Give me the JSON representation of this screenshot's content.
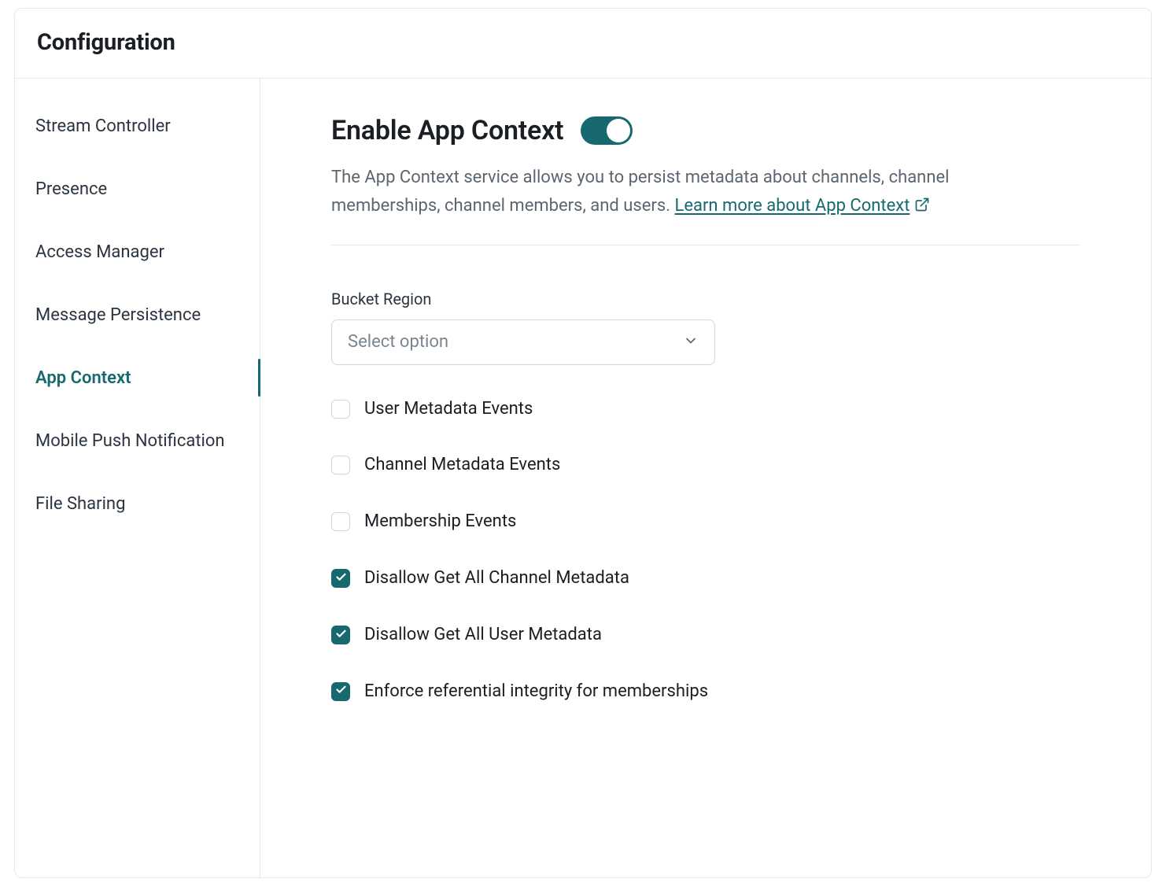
{
  "header": {
    "title": "Configuration"
  },
  "sidebar": {
    "items": [
      {
        "label": "Stream Controller",
        "active": false
      },
      {
        "label": "Presence",
        "active": false
      },
      {
        "label": "Access Manager",
        "active": false
      },
      {
        "label": "Message Persistence",
        "active": false
      },
      {
        "label": "App Context",
        "active": true
      },
      {
        "label": "Mobile Push Notification",
        "active": false
      },
      {
        "label": "File Sharing",
        "active": false
      }
    ]
  },
  "main": {
    "title": "Enable App Context",
    "enabled": true,
    "description": "The App Context service allows you to persist metadata about channels, channel memberships, channel members, and users. ",
    "learn_more": "Learn more about App Context",
    "bucket_region": {
      "label": "Bucket Region",
      "placeholder": "Select option"
    },
    "options": [
      {
        "label": "User Metadata Events",
        "checked": false
      },
      {
        "label": "Channel Metadata Events",
        "checked": false
      },
      {
        "label": "Membership Events",
        "checked": false
      },
      {
        "label": "Disallow Get All Channel Metadata",
        "checked": true
      },
      {
        "label": "Disallow Get All User Metadata",
        "checked": true
      },
      {
        "label": "Enforce referential integrity for memberships",
        "checked": true
      }
    ]
  }
}
